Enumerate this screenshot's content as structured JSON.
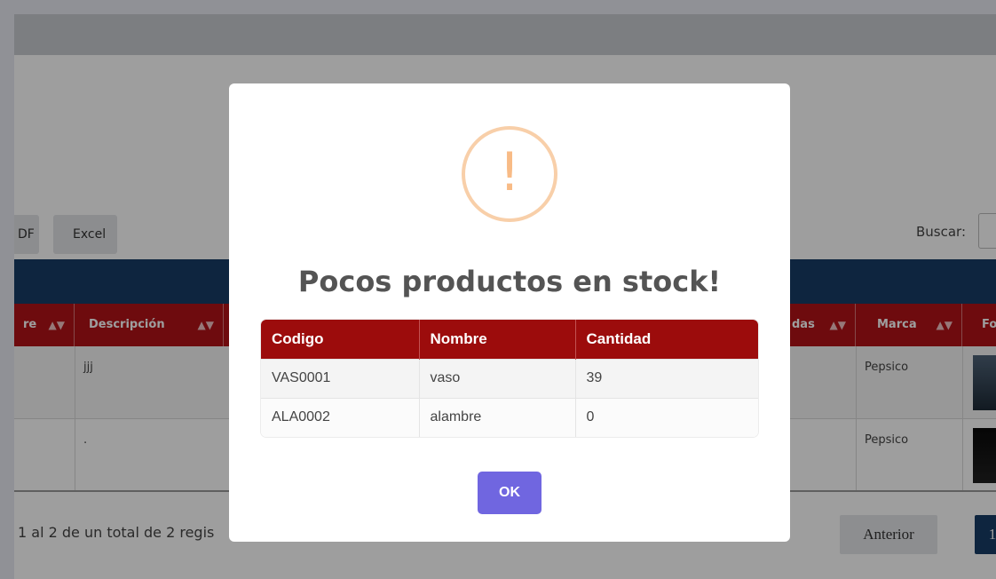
{
  "background_page": {
    "header_title": "",
    "export_buttons": {
      "pdf_label": "DF",
      "excel_label": "Excel"
    },
    "search": {
      "label": "Buscar:",
      "value": ""
    },
    "table": {
      "headers": [
        {
          "label": "re"
        },
        {
          "label": "Descripción"
        },
        {
          "label": "das"
        },
        {
          "label": "Marca"
        },
        {
          "label": "Fo"
        }
      ],
      "rows": [
        {
          "descripcion": "jjj",
          "marca": "Pepsico"
        },
        {
          "descripcion": ".",
          "marca": "Pepsico"
        }
      ]
    },
    "footer": {
      "info": "1 al 2 de un total de 2 regis",
      "prev_label": "Anterior",
      "page_label": "1"
    },
    "colors": {
      "navy": "#173c66",
      "header_red": "#b21217"
    }
  },
  "modal": {
    "icon": "exclamation-warning-icon",
    "icon_glyph": "!",
    "title": "Pocos productos en stock!",
    "table": {
      "headers": [
        "Codigo",
        "Nombre",
        "Cantidad"
      ],
      "rows": [
        [
          "VAS0001",
          "vaso",
          "39"
        ],
        [
          "ALA0002",
          "alambre",
          "0"
        ]
      ]
    },
    "ok_label": "OK",
    "colors": {
      "table_header": "#9c0c0c",
      "ok_button": "#7066e0",
      "icon": "#f8bb86"
    }
  }
}
